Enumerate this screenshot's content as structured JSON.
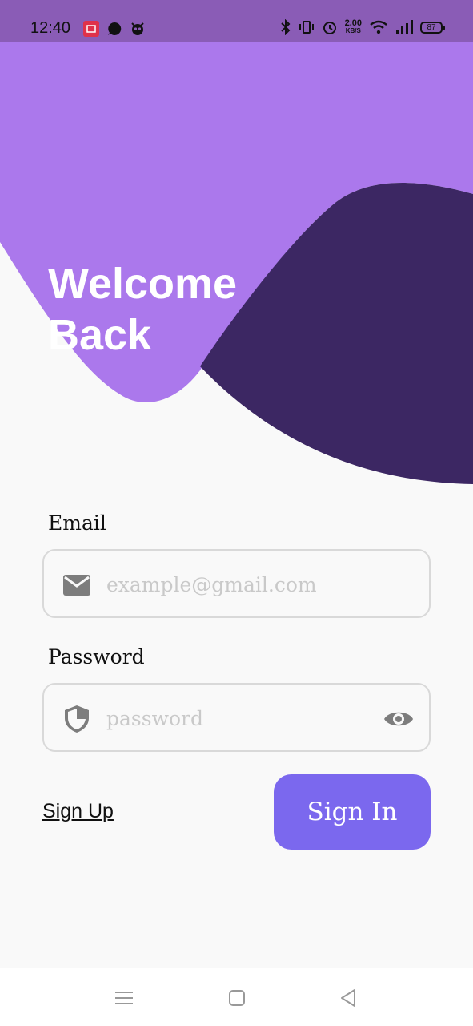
{
  "status_bar": {
    "time": "12:40",
    "net_speed_value": "2.00",
    "net_speed_unit": "KB/S",
    "battery": "87",
    "icons_left": [
      "app-notification-icon",
      "whatsapp-icon",
      "bug-icon"
    ],
    "icons_right": [
      "bluetooth-icon",
      "vibrate-icon",
      "alarm-icon",
      "wifi-icon",
      "signal-icon"
    ]
  },
  "hero": {
    "title_line1": "Welcome",
    "title_line2": "Back",
    "colors": {
      "light": "#ab78ec",
      "dark": "#3c2763"
    }
  },
  "form": {
    "email_label": "Email",
    "email_placeholder": "example@gmail.com",
    "email_value": "",
    "password_label": "Password",
    "password_placeholder": "password",
    "password_value": ""
  },
  "actions": {
    "signup_label": "Sign Up",
    "signin_label": "Sign In",
    "signin_color": "#7b68ee"
  },
  "nav": {
    "buttons": [
      "menu-icon",
      "home-icon",
      "back-icon"
    ]
  }
}
